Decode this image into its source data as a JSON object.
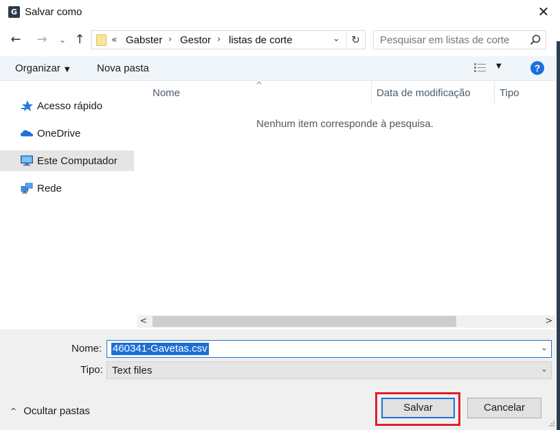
{
  "window": {
    "title": "Salvar como",
    "app_icon_glyph": "G",
    "close_glyph": "✕"
  },
  "nav": {
    "back_glyph": "←",
    "forward_glyph": "→",
    "recent_glyph": "⌄",
    "up_glyph": "↑"
  },
  "address": {
    "overflow_glyph": "«",
    "crumbs": [
      "Gabster",
      "Gestor",
      "listas de corte"
    ],
    "separator": "›",
    "dropdown_glyph": "⌄",
    "refresh_glyph": "↻"
  },
  "search": {
    "placeholder": "Pesquisar em listas de corte"
  },
  "toolbar": {
    "organize_label": "Organizar",
    "new_folder_label": "Nova pasta",
    "help_glyph": "?"
  },
  "sidebar": {
    "items": [
      {
        "label": "Acesso rápido",
        "icon": "star-icon"
      },
      {
        "label": "OneDrive",
        "icon": "cloud-icon"
      },
      {
        "label": "Este Computador",
        "icon": "computer-icon",
        "selected": true
      },
      {
        "label": "Rede",
        "icon": "network-icon"
      }
    ]
  },
  "columns": {
    "name": "Nome",
    "modified": "Data de modificação",
    "type": "Tipo"
  },
  "content": {
    "empty_message": "Nenhum item corresponde à pesquisa."
  },
  "form": {
    "name_label": "Nome:",
    "name_value": "460341-Gavetas.csv",
    "type_label": "Tipo:",
    "type_value": "Text files",
    "hide_folders_label": "Ocultar pastas",
    "save_label": "Salvar",
    "cancel_label": "Cancelar"
  },
  "colors": {
    "accent": "#1e6fd9",
    "highlight": "#e11d2a",
    "selection": "#1f6ed4"
  }
}
